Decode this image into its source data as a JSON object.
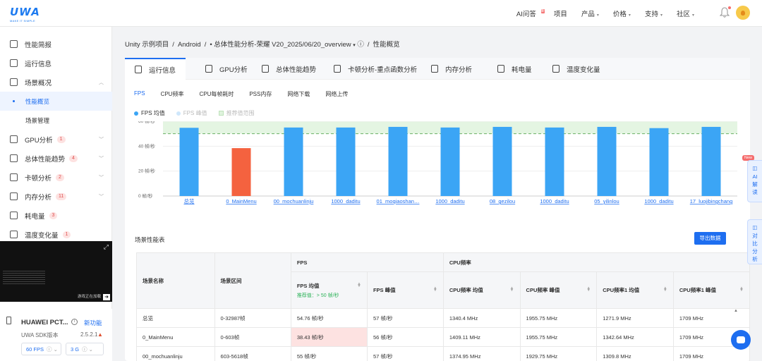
{
  "brand": {
    "name": "UWA",
    "tagline": "MAKE IT SIMPLE"
  },
  "topnav": {
    "items": [
      {
        "label": "AI问答",
        "badge": "新",
        "caret": false
      },
      {
        "label": "项目",
        "caret": false
      },
      {
        "label": "产品",
        "caret": true
      },
      {
        "label": "价格",
        "caret": true
      },
      {
        "label": "支持",
        "caret": true
      },
      {
        "label": "社区",
        "caret": true
      }
    ]
  },
  "sidebar": {
    "items": [
      {
        "label": "性能简报",
        "icon": "pulse-icon"
      },
      {
        "label": "运行信息",
        "icon": "monitor-icon"
      },
      {
        "label": "场景概况",
        "icon": "scene-icon",
        "expanded": true
      },
      {
        "label": "GPU分析",
        "icon": "gpu-icon",
        "count": "1"
      },
      {
        "label": "总体性能趋势",
        "icon": "trend-icon",
        "count": "4"
      },
      {
        "label": "卡顿分析",
        "icon": "stutter-icon",
        "count": "2"
      },
      {
        "label": "内存分析",
        "icon": "memory-icon",
        "count": "11"
      },
      {
        "label": "耗电量",
        "icon": "battery-icon",
        "count": "3"
      },
      {
        "label": "温度变化量",
        "icon": "thermometer-icon",
        "count": "1"
      }
    ],
    "sub_items": [
      {
        "label": "性能概览",
        "active": true
      },
      {
        "label": "场景管理",
        "active": false
      }
    ],
    "video_caption": "游戏正在加载",
    "device": {
      "name": "HUAWEI PCT...",
      "new_feature": "新功能",
      "sdk_label": "UWA SDK版本",
      "sdk_version": "2.5.2.1",
      "fps_select": "60 FPS",
      "mem_select": "3 G"
    }
  },
  "breadcrumb": {
    "project": "Unity 示例项目",
    "platform": "Android",
    "report": "总体性能分析-荣耀 V20_2025/06/20_overview",
    "page": "性能概览"
  },
  "tabs": [
    {
      "label": "运行信息",
      "icon": "monitor-icon",
      "active": true
    },
    {
      "label": "GPU分析",
      "icon": "gpu-icon"
    },
    {
      "label": "总体性能趋势",
      "icon": "trend-icon"
    },
    {
      "label": "卡顿分析-重点函数分析",
      "icon": "stutter-icon"
    },
    {
      "label": "内存分析",
      "icon": "memory-icon"
    },
    {
      "label": "耗电量",
      "icon": "battery-icon"
    },
    {
      "label": "温度变化量",
      "icon": "thermometer-icon"
    }
  ],
  "subtabs": [
    "FPS",
    "CPU频率",
    "CPU每帧耗时",
    "PSS内存",
    "网络下载",
    "网络上传"
  ],
  "legend": {
    "avg": "FPS 均值",
    "peak": "FPS 峰值",
    "range": "推荐值范围"
  },
  "chart_data": {
    "type": "bar",
    "categories": [
      "总览",
      "0_MainMenu",
      "00_mochuanlinju",
      "1000_daditu",
      "01_moqiaoshan…",
      "1000_daditu",
      "08_gezilou",
      "1000_daditu",
      "05_yilinlou",
      "1000_daditu",
      "17_luojibingchang"
    ],
    "series": [
      {
        "name": "FPS 均值",
        "values": [
          54.76,
          38.43,
          55,
          55,
          55.5,
          55,
          55.5,
          55,
          55.5,
          54.5,
          55.5
        ]
      }
    ],
    "highlight_index": 1,
    "yticks": [
      "0 帧/秒",
      "20 帧/秒",
      "40 帧/秒",
      "60 帧/秒"
    ],
    "ylim": [
      0,
      60
    ],
    "recommended_range": [
      50,
      60
    ],
    "threshold": 50,
    "colors": {
      "bar": "#3ba5f5",
      "bad": "#f4623f",
      "band": "#e4f5e2",
      "threshold": "#6aaf64"
    },
    "grid": true
  },
  "table": {
    "title": "场景性能表",
    "export_label": "导出数据",
    "group_headers": {
      "fps": "FPS",
      "cpu": "CPU频率"
    },
    "col_scene": "场景名称",
    "col_range": "场景区间",
    "columns": [
      "FPS 均值",
      "FPS 峰值",
      "CPU频率 均值",
      "CPU频率 峰值",
      "CPU频率1 均值",
      "CPU频率1 峰值"
    ],
    "fps_hint": "推荐值：> 50 帧/秒",
    "rows": [
      {
        "name": "总览",
        "range": "0-32987帧",
        "vals": [
          "54.76 帧/秒",
          "57 帧/秒",
          "1340.4 MHz",
          "1955.75 MHz",
          "1271.9 MHz",
          "1709 MHz"
        ]
      },
      {
        "name": "0_MainMenu",
        "range": "0-603帧",
        "vals": [
          "38.43 帧/秒",
          "56 帧/秒",
          "1409.11 MHz",
          "1955.75 MHz",
          "1342.64 MHz",
          "1709 MHz"
        ],
        "bad": true
      },
      {
        "name": "00_mochuanlinju",
        "range": "603-5618帧",
        "vals": [
          "55 帧/秒",
          "57 帧/秒",
          "1374.95 MHz",
          "1929.75 MHz",
          "1309.8 MHz",
          "1709 MHz"
        ]
      }
    ]
  },
  "float_buttons": {
    "ai": "AI解读",
    "compare": "对比分析",
    "new_tag": "New"
  }
}
